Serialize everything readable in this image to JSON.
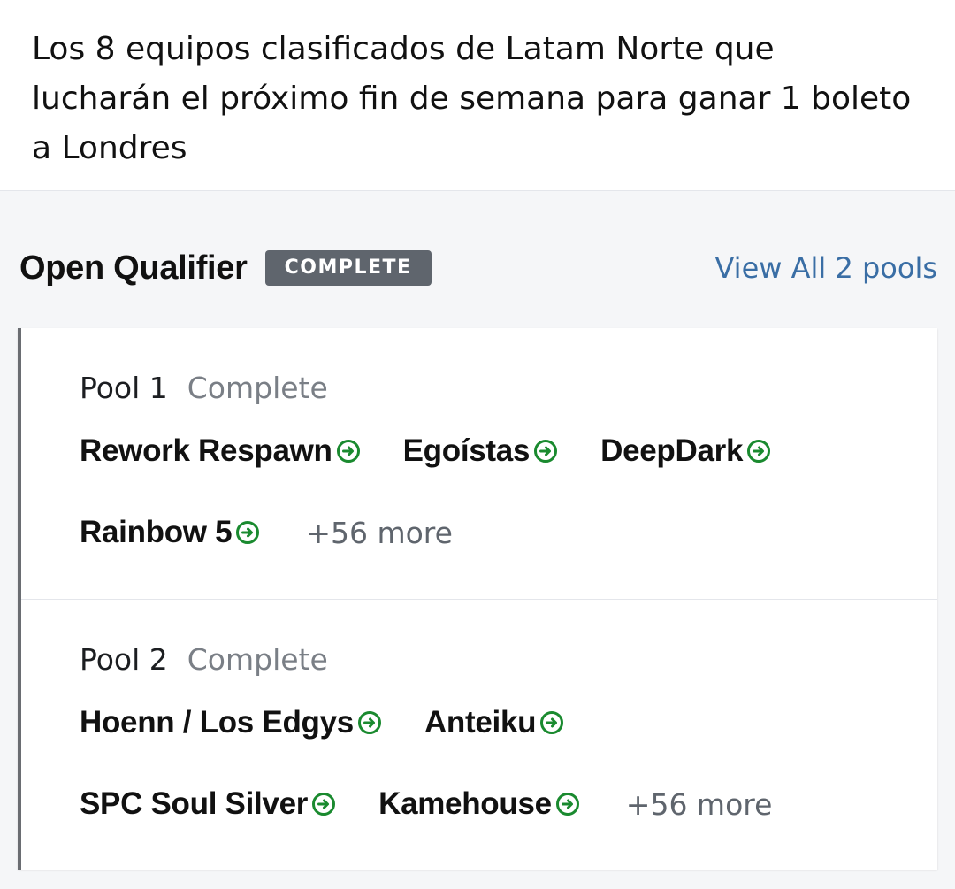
{
  "post": {
    "text": "Los 8 equipos clasificados de Latam Norte que lucharán el próximo fin de semana para ganar 1 boleto a Londres"
  },
  "qualifier": {
    "title": "Open Qualifier",
    "status": "COMPLETE",
    "view_all": "View All 2 pools"
  },
  "pools": [
    {
      "name": "Pool 1",
      "status": "Complete",
      "row1": [
        "Rework Respawn",
        "Egoístas",
        "DeepDark"
      ],
      "row2": [
        "Rainbow 5"
      ],
      "more": "+56 more"
    },
    {
      "name": "Pool 2",
      "status": "Complete",
      "row1": [
        "Hoenn / Los Edgys",
        "Anteiku"
      ],
      "row2": [
        "SPC Soul Silver",
        "Kamehouse"
      ],
      "more": "+56 more"
    }
  ],
  "icons": {
    "qualified": "arrow-circle-right-icon"
  },
  "colors": {
    "qualified_green": "#1a8a2f",
    "badge_gray": "#5f656d",
    "link_blue": "#3a6ea5"
  }
}
